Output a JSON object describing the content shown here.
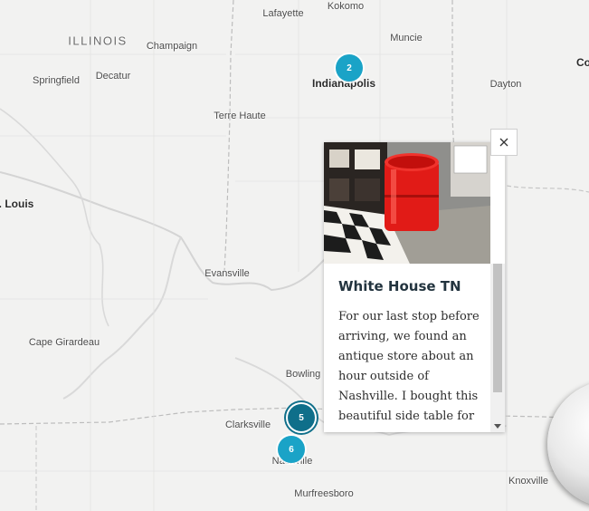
{
  "map": {
    "places": {
      "illinois": "ILLINOIS",
      "lafayette": "Lafayette",
      "kokomo": "Kokomo",
      "muncie": "Muncie",
      "champaign": "Champaign",
      "springfield": "Springfield",
      "decatur": "Decatur",
      "indianapolis": "Indianapolis",
      "dayton": "Dayton",
      "columbus_partial": "Co",
      "terre_haute": "Terre Haute",
      "st_louis_partial": ". Louis",
      "evansville": "Evansville",
      "cape_girardeau": "Cape Girardeau",
      "bowling_green_partial": "Bowling",
      "clarksville": "Clarksville",
      "nashville": "Nashville",
      "murfreesboro": "Murfreesboro",
      "knoxville": "Knoxville"
    },
    "clusters": {
      "indianapolis": "2",
      "nashville_selected": "5",
      "nashville_south": "6"
    }
  },
  "popup": {
    "title": "White House TN",
    "description": "For our last stop before arriving, we found an antique store about an hour outside of Nashville. I bought this beautiful side table for",
    "close_label": "×"
  },
  "colors": {
    "cluster": "#1aa3c7",
    "cluster_selected": "#0f6f8a",
    "title": "#23343f"
  }
}
